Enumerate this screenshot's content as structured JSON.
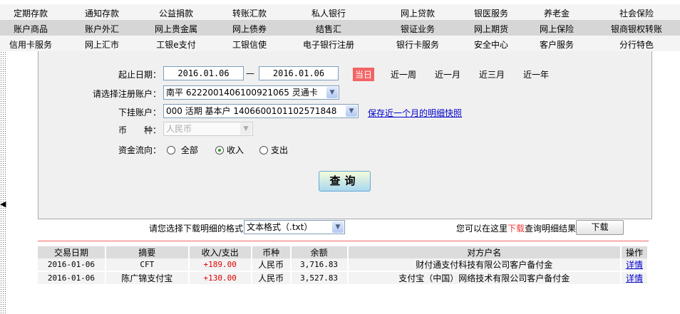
{
  "nav": [
    [
      "定期存款",
      "通知存款",
      "公益捐款",
      "转账汇款",
      "私人银行",
      "网上贷款",
      "银医服务",
      "养老金",
      "社会保险"
    ],
    [
      "账户商品",
      "账户外汇",
      "网上贵金属",
      "网上债券",
      "结售汇",
      "银证业务",
      "网上期货",
      "网上保险",
      "银商银权转账"
    ],
    [
      "信用卡服务",
      "网上汇市",
      "工银e支付",
      "工银信使",
      "电子银行注册",
      "银行卡服务",
      "安全中心",
      "客户服务",
      "分行特色"
    ]
  ],
  "form": {
    "date_label": "起止日期：",
    "date_from": "2016.01.06",
    "dash": "—",
    "date_to": "2016.01.06",
    "quick": [
      "当日",
      "近一周",
      "近一月",
      "近三月",
      "近一年"
    ],
    "reg_label": "请选择注册账户：",
    "reg_value": "南平 6222001406100921065 灵通卡",
    "sub_label": "下挂账户：",
    "sub_value": "000 活期 基本户 1406600101102571848",
    "snapshot_link": "保存近一个月的明细快照",
    "currency_label": "币　　种：",
    "currency_value": "人民币",
    "flow_label": "资金流向：",
    "flow_options": [
      "全部",
      "收入",
      "支出"
    ],
    "flow_selected": "收入",
    "query_button": "查询"
  },
  "download": {
    "format_label": "请您选择下载明细的格式",
    "format_value": "文本格式（.txt）",
    "hint_pre": "您可以在这里",
    "hint_red": "下载",
    "hint_post": "查询明细结果",
    "button": "下载"
  },
  "table": {
    "headers": [
      "交易日期",
      "摘要",
      "收入/支出",
      "币种",
      "余额",
      "对方户名",
      "操作"
    ],
    "rows": [
      [
        "2016-01-06",
        "CFT",
        "+189.00",
        "人民币",
        "3,716.83",
        "财付通支付科技有限公司客户备付金",
        "详情"
      ],
      [
        "2016-01-06",
        "陈广锦支付宝",
        "+130.00",
        "人民币",
        "3,527.83",
        "支付宝（中国）网络技术有限公司客户备付金",
        "详情"
      ]
    ]
  },
  "colors": {
    "accent_red": "#f36466",
    "link": "#0000cc",
    "amount": "#dd0000"
  },
  "icons": {
    "collapse": "left-arrow-icon",
    "dropdown": "chevron-down-icon"
  }
}
